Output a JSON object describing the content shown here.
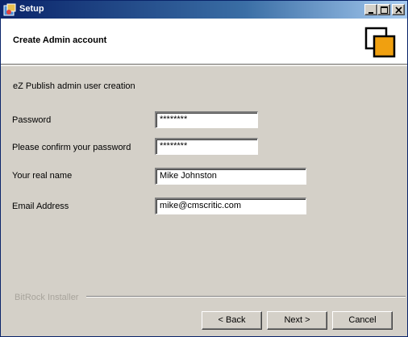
{
  "window": {
    "title": "Setup"
  },
  "header": {
    "title": "Create Admin account"
  },
  "form": {
    "subtitle": "eZ Publish admin user creation",
    "password": {
      "label": "Password",
      "value": "********"
    },
    "confirm_password": {
      "label": "Please confirm your password",
      "value": "********"
    },
    "real_name": {
      "label": "Your real name",
      "value": "Mike Johnston"
    },
    "email": {
      "label": "Email Address",
      "value": "mike@cmscritic.com"
    }
  },
  "footer": {
    "brand": "BitRock Installer",
    "back_label": "< Back",
    "next_label": "Next >",
    "cancel_label": "Cancel"
  },
  "colors": {
    "accent": "#f0a010",
    "titlebar": "#0a246a",
    "panel": "#d4d0c8"
  },
  "icons": [
    "setup-app-icon",
    "minimize-icon",
    "maximize-icon",
    "close-icon",
    "installer-logo-icon"
  ]
}
